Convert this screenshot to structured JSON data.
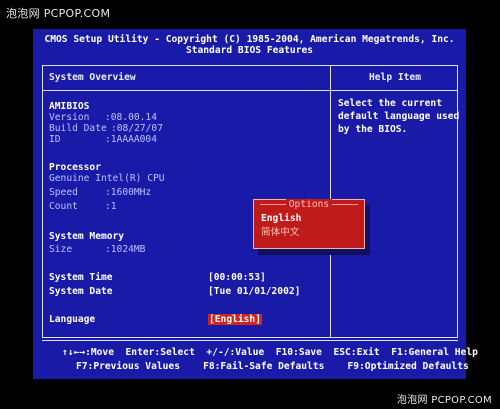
{
  "watermark_top": "泡泡网 PCPOP.COM",
  "watermark_bottom": "泡泡网 PCPOP.COM",
  "header": {
    "line1": "CMOS Setup Utility - Copyright (C) 1985-2004, American Megatrends, Inc.",
    "line2": "Standard BIOS Features"
  },
  "overview": {
    "title": "System Overview",
    "bios_name": "AMIBIOS",
    "version_label": "Version",
    "version_value": ":08.00.14",
    "build_label": "Build Date",
    "build_value": ":08/27/07",
    "id_label": "ID",
    "id_value": ":1AAAA004",
    "processor_heading": "Processor",
    "cpu_name": "Genuine Intel(R) CPU",
    "speed_label": "Speed",
    "speed_value": ":1600MHz",
    "count_label": "Count",
    "count_value": ":1",
    "memory_heading": "System Memory",
    "size_label": "Size",
    "size_value": ":1024MB",
    "time_label": "System Time",
    "time_value": "[00:00:53]",
    "date_label": "System Date",
    "date_value": "[Tue 01/01/2002]",
    "language_label": "Language",
    "language_value": "[English]"
  },
  "help": {
    "title": "Help Item",
    "text": "Select the current\ndefault language used\nby the BIOS."
  },
  "popup": {
    "title": "Options",
    "options": [
      "English",
      "简体中文"
    ],
    "selected": "English"
  },
  "footer": {
    "line1": "↑↓←→:Move  Enter:Select  +/-/:Value  F10:Save  ESC:Exit  F1:General Help",
    "line2": "F7:Previous Values    F8:Fail-Safe Defaults    F9:Optimized Defaults"
  },
  "colors": {
    "bios_background": "#1a1aa8",
    "highlight": "#d3231e",
    "popup_background": "#c01b1b"
  }
}
